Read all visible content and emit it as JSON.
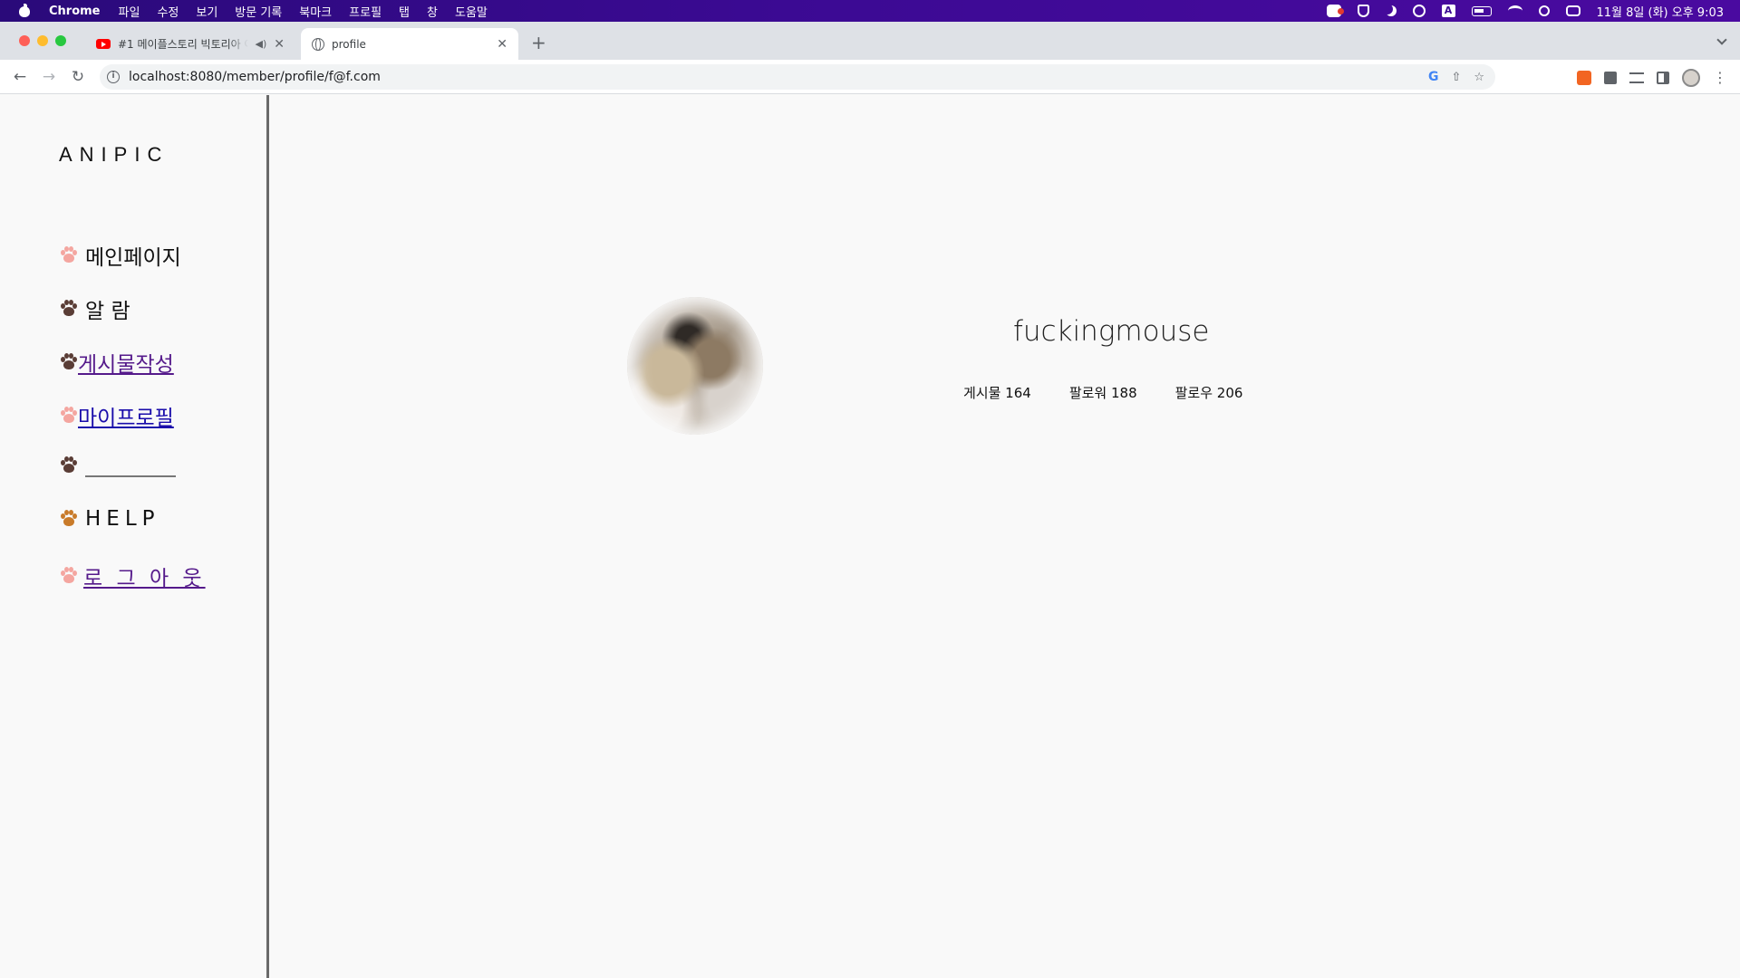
{
  "menubar": {
    "app": "Chrome",
    "items": [
      "파일",
      "수정",
      "보기",
      "방문 기록",
      "북마크",
      "프로필",
      "탭",
      "창",
      "도움말"
    ],
    "clock": "11월 8일 (화) 오후 9:03",
    "tray_a": "A"
  },
  "tabs": [
    {
      "title": "#1 메이플스토리 빅토리아 아일랜",
      "icon": "youtube-icon"
    },
    {
      "title": "profile",
      "icon": "globe-icon"
    }
  ],
  "toolbar": {
    "url": "localhost:8080/member/profile/f@f.com",
    "google_label": "G"
  },
  "sidebar": {
    "logo": "ANIPIC",
    "items": [
      {
        "label": "메인페이지",
        "paw_color": "#f4a6a0"
      },
      {
        "label": "알 람",
        "paw_color": "#5a3d36"
      },
      {
        "label": "게시물작성",
        "paw_color": "#5a3d36"
      },
      {
        "label": "마이프로필",
        "paw_color": "#f4a6a0"
      },
      {
        "label": "",
        "paw_color": "#5a3d36"
      },
      {
        "label": "HELP",
        "paw_color": "#c97b2a"
      },
      {
        "label": "로 그 아 웃",
        "paw_color": "#f4a6a0"
      }
    ]
  },
  "profile": {
    "username": "fuckingmouse",
    "posts": "게시물 164",
    "followers": "팔로워 188",
    "following": "팔로우 206"
  },
  "colors": {
    "menubar": "#3b0a93",
    "link": "#1a0dab",
    "visited_link": "#551a8b",
    "page_bg": "#f9f9f9"
  }
}
